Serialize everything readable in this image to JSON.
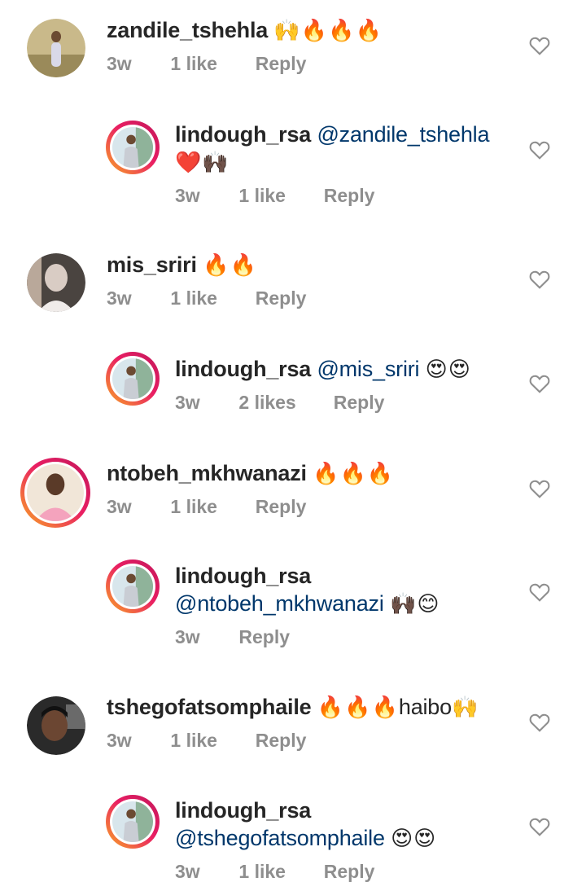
{
  "comments": [
    {
      "username": "zandile_tshehla",
      "emoji": "🙌🔥🔥🔥",
      "time": "3w",
      "likes": "1 like",
      "reply_label": "Reply"
    },
    {
      "username": "lindough_rsa",
      "mention": "@zandile_tshehla",
      "emoji": "❤️🙌🏿",
      "time": "3w",
      "likes": "1 like",
      "reply_label": "Reply"
    },
    {
      "username": "mis_sriri",
      "emoji": "🔥🔥",
      "time": "3w",
      "likes": "1 like",
      "reply_label": "Reply"
    },
    {
      "username": "lindough_rsa",
      "mention": "@mis_sriri",
      "emoji": "😍😍",
      "time": "3w",
      "likes": "2 likes",
      "reply_label": "Reply"
    },
    {
      "username": "ntobeh_mkhwanazi",
      "emoji": "🔥🔥🔥",
      "time": "3w",
      "likes": "1 like",
      "reply_label": "Reply"
    },
    {
      "username": "lindough_rsa",
      "mention": "@ntobeh_mkhwanazi",
      "emoji": "🙌🏿😊",
      "time": "3w",
      "likes": "",
      "reply_label": "Reply"
    },
    {
      "username": "tshegofatsomphaile",
      "emoji": "🔥🔥🔥",
      "text": "haibo",
      "emoji2": "🙌",
      "time": "3w",
      "likes": "1 like",
      "reply_label": "Reply"
    },
    {
      "username": "lindough_rsa",
      "mention": "@tshegofatsomphaile",
      "emoji": "😍😍",
      "time": "3w",
      "likes": "1 like",
      "reply_label": "Reply"
    }
  ],
  "icons": {
    "like": "heart-outline-icon"
  },
  "colors": {
    "mention": "#00376b",
    "meta": "#8e8e8e",
    "story_ring_start": "#f9a825",
    "story_ring_end": "#c2185b"
  }
}
